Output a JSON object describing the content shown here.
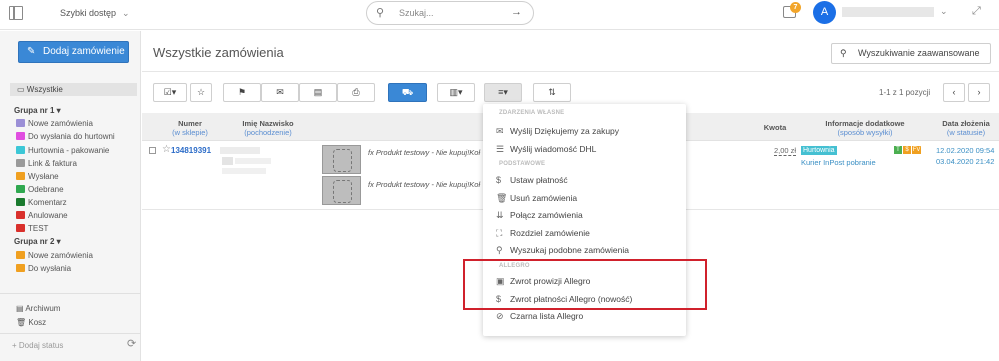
{
  "topbar": {
    "quick_access": "Szybki dostęp",
    "search_placeholder": "Szukaj...",
    "notification_count": "7",
    "avatar_letter": "A"
  },
  "sidebar": {
    "add_order": "Dodaj zamówienie",
    "all": "Wszystkie",
    "group1": "Grupa nr 1 ▾",
    "group1_items": [
      {
        "label": "Nowe zamówienia",
        "color": "#9b8fd6"
      },
      {
        "label": "Do wysłania do hurtowni",
        "color": "#e04ee0"
      },
      {
        "label": "Hurtownia - pakowanie",
        "color": "#3cc7d6"
      },
      {
        "label": "Link & faktura",
        "color": "#9a9a9a"
      },
      {
        "label": "Wysłane",
        "color": "#f0a020"
      },
      {
        "label": "Odebrane",
        "color": "#2fa84f"
      },
      {
        "label": "Komentarz",
        "color": "#1a7a2e"
      },
      {
        "label": "Anulowane",
        "color": "#d9302c"
      },
      {
        "label": "TEST",
        "color": "#d9302c"
      }
    ],
    "group2": "Grupa nr 2 ▾",
    "group2_items": [
      {
        "label": "Nowe zamówienia",
        "color": "#f0a020"
      },
      {
        "label": "Do wysłania",
        "color": "#f0a020"
      }
    ],
    "archive": "Archiwum",
    "trash": "Kosz",
    "add_status": "+ Dodaj status"
  },
  "main": {
    "title": "Wszystkie zamówienia",
    "adv_search": "Wyszukiwanie zaawansowane",
    "pagination": "1-1 z 1 pozycji",
    "headers": {
      "numer": "Numer",
      "numer_sub": "(w sklepie)",
      "imie": "Imię Nazwisko",
      "imie_sub": "(pochodzenie)",
      "kwota": "Kwota",
      "info": "Informacje dodatkowe",
      "info_sub": "(sposób wysyłki)",
      "data": "Data złożenia",
      "data_sub": "(w statusie)"
    },
    "order": {
      "number": "134819391",
      "product1": "fx Produkt testowy - Nie kupuj!Koł",
      "product2": "fx Produkt testowy - Nie kupuj!Koł",
      "amount": "2,00 zł",
      "status": "Hurtownia",
      "badge_t": "T",
      "badge_s": "$",
      "badge_fv": "FV",
      "shipping": "Kurier InPost pobranie",
      "date_created": "12.02.2020 09:54",
      "date_status": "03.04.2020 21:42"
    }
  },
  "menu": {
    "section1": "ZDARZENIA WŁASNE",
    "items1": [
      "Wyślij Dziękujemy za zakupy",
      "Wyślij wiadomość DHL"
    ],
    "section2": "PODSTAWOWE",
    "items2": [
      "Ustaw płatność",
      "Usuń zamówienia",
      "Połącz zamówienia",
      "Rozdziel zamówienie",
      "Wyszukaj podobne zamówienia"
    ],
    "section3": "ALLEGRO",
    "items3": [
      "Zwrot prowizji Allegro",
      "Zwrot płatności Allegro (nowość)",
      "Czarna lista Allegro"
    ]
  }
}
